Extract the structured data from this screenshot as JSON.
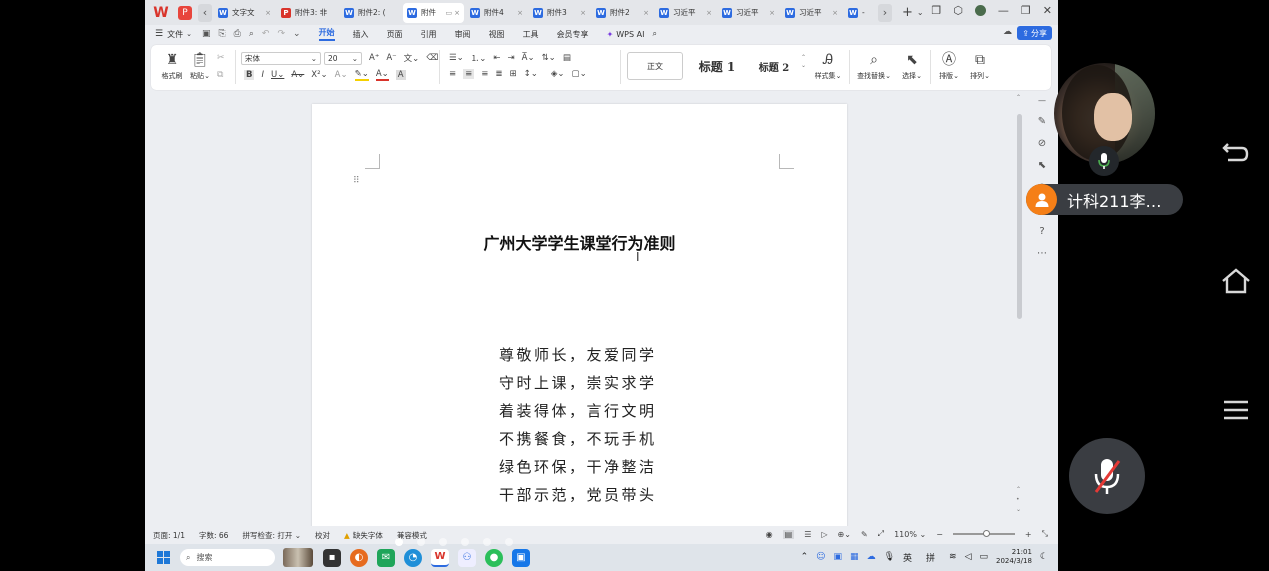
{
  "tabbar": {
    "tabs": [
      {
        "label": "文字文",
        "icon": "word",
        "active": false
      },
      {
        "label": "附件3: 非",
        "icon": "pdf",
        "active": false
      },
      {
        "label": "附件2: (",
        "icon": "word",
        "active": false
      },
      {
        "label": "附件",
        "icon": "word",
        "active": true
      },
      {
        "label": "附件4",
        "icon": "word",
        "active": false
      },
      {
        "label": "附件3",
        "icon": "word",
        "active": false
      },
      {
        "label": "附件2",
        "icon": "word",
        "active": false
      },
      {
        "label": "习近平",
        "icon": "word",
        "active": false
      },
      {
        "label": "习近平",
        "icon": "word",
        "active": false
      },
      {
        "label": "习近平",
        "icon": "word",
        "active": false
      },
      {
        "label": "-",
        "icon": "word",
        "active": false
      }
    ]
  },
  "menubar": {
    "file": "文件",
    "items": [
      "开始",
      "插入",
      "页面",
      "引用",
      "审阅",
      "视图",
      "工具",
      "会员专享"
    ],
    "active": "开始",
    "wps_ai": "WPS AI",
    "share": "分享"
  },
  "ribbon": {
    "format_painter": "格式刷",
    "paste": "粘贴",
    "font_name": "宋体",
    "font_size": "20",
    "style_normal": "正文",
    "style_h1": "标题 1",
    "style_h2": "标题 2",
    "style_set": "样式集",
    "find_replace": "查找替换",
    "select": "选择",
    "layout": "排版",
    "arrange": "排列"
  },
  "document": {
    "title": "广州大学学生课堂行为准则",
    "lines": [
      "尊敬师长，友爱同学",
      "守时上课，崇实求学",
      "着装得体，言行文明",
      "不携餐食，不玩手机",
      "绿色环保，干净整洁",
      "干部示范，党员带头"
    ]
  },
  "statusbar": {
    "page": "页面: 1/1",
    "word_count": "字数: 66",
    "spell_check": "拼写检查: 打开",
    "proofread": "校对",
    "missing_font": "缺失字体",
    "compat_mode": "兼容模式",
    "zoom": "110%"
  },
  "taskbar": {
    "search_placeholder": "搜索",
    "ime_lang": "英",
    "ime_mode": "拼",
    "time": "21:01",
    "date": "2024/3/18"
  },
  "meeting": {
    "participant_name": "计科211李…"
  },
  "colors": {
    "accent": "#2d6be0",
    "participant_badge": "#f57f17",
    "wps_red": "#d9342b"
  }
}
